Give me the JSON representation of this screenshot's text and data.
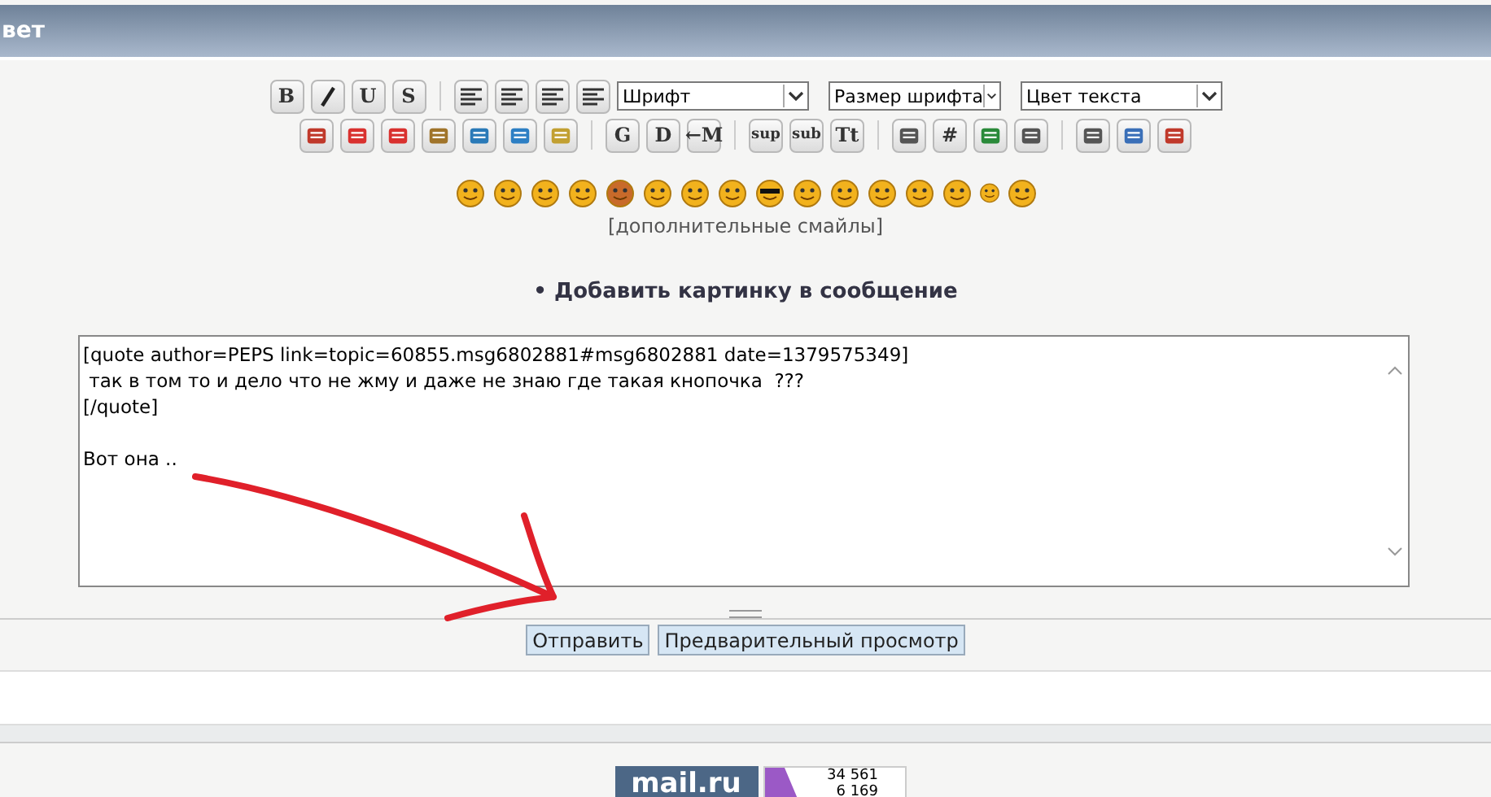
{
  "header": {
    "title": "вет"
  },
  "toolbar": {
    "row1": [
      {
        "kind": "text",
        "label": "B"
      },
      {
        "kind": "icon"
      },
      {
        "kind": "text",
        "label": "U"
      },
      {
        "kind": "text",
        "label": "S"
      },
      {
        "kind": "sep"
      },
      {
        "kind": "icon"
      },
      {
        "kind": "icon"
      },
      {
        "kind": "icon"
      },
      {
        "kind": "icon"
      }
    ],
    "selects": [
      {
        "value": "Шрифт"
      },
      {
        "value": "Размер шрифта"
      },
      {
        "value": "Цвет текста"
      }
    ],
    "row2": [
      {
        "kind": "icon"
      },
      {
        "kind": "icon"
      },
      {
        "kind": "icon"
      },
      {
        "kind": "icon"
      },
      {
        "kind": "icon"
      },
      {
        "kind": "icon"
      },
      {
        "kind": "icon"
      },
      {
        "kind": "sep"
      },
      {
        "kind": "text",
        "label": "G"
      },
      {
        "kind": "text",
        "label": "D"
      },
      {
        "kind": "text",
        "label": "←M"
      },
      {
        "kind": "sep"
      },
      {
        "kind": "text",
        "label": "sup"
      },
      {
        "kind": "text",
        "label": "sub"
      },
      {
        "kind": "text",
        "label": "Tt"
      },
      {
        "kind": "sep"
      },
      {
        "kind": "icon"
      },
      {
        "kind": "text",
        "label": "#"
      },
      {
        "kind": "icon"
      },
      {
        "kind": "icon"
      },
      {
        "kind": "sep"
      },
      {
        "kind": "icon"
      },
      {
        "kind": "icon"
      },
      {
        "kind": "icon"
      }
    ]
  },
  "smileys": {
    "count_link": "[дополнительные смайлы]"
  },
  "add_image_link": "• Добавить картинку в сообщение",
  "message": {
    "value": "[quote author=PEPS link=topic=60855.msg6802881#msg6802881 date=1379575349]\n так в том то и дело что не жму и даже не знаю где такая кнопочка  ???\n[/quote]\n\nВот она .."
  },
  "buttons": [
    {
      "label": "Отправить"
    },
    {
      "label": "Предварительный просмотр"
    }
  ],
  "footer": {
    "mail_logo": "mail.ru",
    "counter": [
      "34 561",
      "6 169"
    ]
  }
}
